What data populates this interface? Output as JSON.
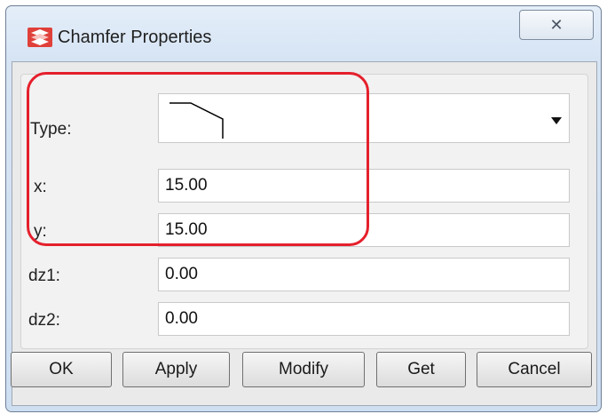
{
  "window": {
    "title": "Chamfer Properties",
    "close_glyph": "✕"
  },
  "form": {
    "type_label": "Type:",
    "type_icon": "chamfer-profile-icon",
    "x_label": "x:",
    "x_value": "15.00",
    "y_label": "y:",
    "y_value": "15.00",
    "dz1_label": "dz1:",
    "dz1_value": "0.00",
    "dz2_label": "dz2:",
    "dz2_value": "0.00"
  },
  "buttons": {
    "ok": "OK",
    "apply": "Apply",
    "modify": "Modify",
    "get": "Get",
    "cancel": "Cancel"
  },
  "colors": {
    "highlight": "#e5202c",
    "title_bar": "#d6e4f4"
  }
}
